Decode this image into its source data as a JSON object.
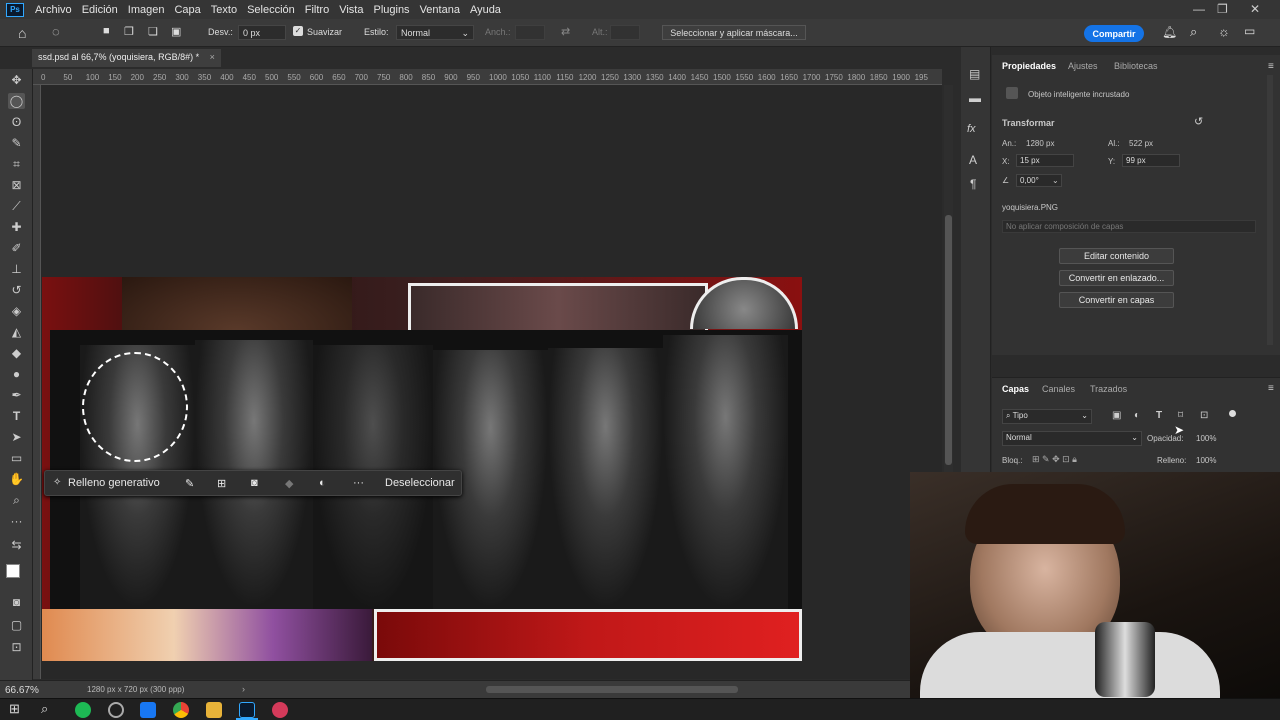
{
  "app": {
    "logo_text": "Ps"
  },
  "menu": [
    "Archivo",
    "Edición",
    "Imagen",
    "Capa",
    "Texto",
    "Selección",
    "Filtro",
    "Vista",
    "Plugins",
    "Ventana",
    "Ayuda"
  ],
  "options_bar": {
    "feather_label": "Desv.:",
    "feather_value": "0 px",
    "antialias_label": "Suavizar",
    "style_label": "Estilo:",
    "style_value": "Normal",
    "width_label": "Anch.:",
    "height_label": "Alt.:",
    "mask_button": "Seleccionar y aplicar máscara...",
    "share_button": "Compartir"
  },
  "document": {
    "tab_title": "ssd.psd al 66,7% (yoquisiera, RGB/8#) *",
    "zoom": "66.67%",
    "status_info": "1280 px x 720 px (300 ppp)"
  },
  "ruler_ticks": [
    "0",
    "50",
    "100",
    "150",
    "200",
    "250",
    "300",
    "350",
    "400",
    "450",
    "500",
    "550",
    "600",
    "650",
    "700",
    "750",
    "800",
    "850",
    "900",
    "950",
    "1000",
    "1050",
    "1100",
    "1150",
    "1200",
    "1250",
    "1300",
    "1350",
    "1400",
    "1450",
    "1500",
    "1550",
    "1600",
    "1650",
    "1700",
    "1750",
    "1800",
    "1850",
    "1900",
    "195"
  ],
  "context_bar": {
    "generative_fill": "Relleno generativo",
    "deselect": "Deseleccionar"
  },
  "properties": {
    "tabs": [
      "Propiedades",
      "Ajustes",
      "Bibliotecas"
    ],
    "object_type": "Objeto inteligente incrustado",
    "transform_heading": "Transformar",
    "width_label": "An.:",
    "width_value": "1280 px",
    "height_label": "Al.:",
    "height_value": "522 px",
    "x_label": "X:",
    "x_value": "15 px",
    "y_label": "Y:",
    "y_value": "99 px",
    "angle_value": "0,00°",
    "file_name": "yoquisiera.PNG",
    "comp_placeholder": "No aplicar composición de capas",
    "edit_button": "Editar contenido",
    "link_button": "Convertir en enlazado...",
    "layers_button": "Convertir en capas"
  },
  "layers_panel": {
    "tabs": [
      "Capas",
      "Canales",
      "Trazados"
    ],
    "filter_value": "Tipo",
    "blend_mode": "Normal",
    "opacity_label": "Opacidad:",
    "opacity_value": "100%",
    "lock_label": "Bloq.:",
    "fill_label": "Relleno:",
    "fill_value": "100%"
  },
  "colors": {
    "share_blue": "#1473e6",
    "ps_blue": "#31a8ff",
    "panel_bg": "#323232",
    "toolbar_bg": "#3a3a3a",
    "art_red": "#8a1010"
  }
}
